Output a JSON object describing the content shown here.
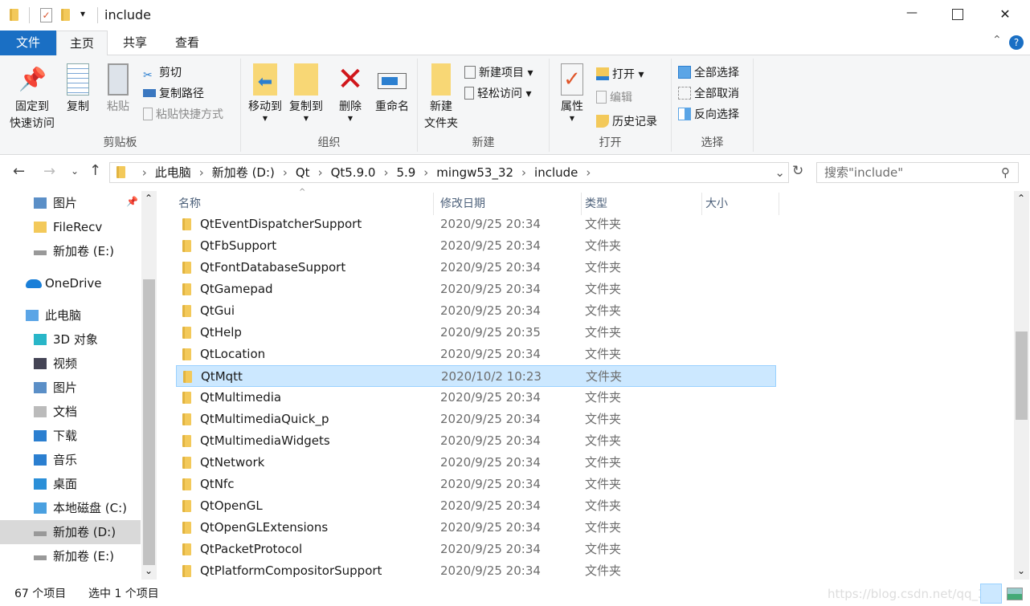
{
  "window": {
    "title": "include",
    "qat_dropdown": "▾",
    "minimize": "—",
    "maximize": "☐",
    "close": "✕"
  },
  "tabs": [
    {
      "label": "文件"
    },
    {
      "label": "主页"
    },
    {
      "label": "共享"
    },
    {
      "label": "查看"
    }
  ],
  "ribbon": {
    "clipboard": {
      "label": "剪贴板",
      "pin": "固定到",
      "pin2": "快速访问",
      "copy": "复制",
      "paste": "粘贴",
      "cut": "剪切",
      "copy_path": "复制路径",
      "paste_shortcut": "粘贴快捷方式"
    },
    "organize": {
      "label": "组织",
      "move_to": "移动到",
      "copy_to": "复制到",
      "delete": "删除",
      "rename": "重命名"
    },
    "new": {
      "label": "新建",
      "new_folder": "新建",
      "new_folder2": "文件夹",
      "new_item": "新建项目 ▾",
      "easy_access": "轻松访问 ▾"
    },
    "open": {
      "label": "打开",
      "properties": "属性",
      "open": "打开 ▾",
      "edit": "编辑",
      "history": "历史记录"
    },
    "select": {
      "label": "选择",
      "select_all": "全部选择",
      "select_none": "全部取消",
      "invert": "反向选择"
    }
  },
  "address": {
    "crumbs": [
      "此电脑",
      "新加卷 (D:)",
      "Qt",
      "Qt5.9.0",
      "5.9",
      "mingw53_32",
      "include"
    ],
    "search_placeholder": "搜索\"include\""
  },
  "nav": [
    {
      "label": "图片",
      "icon": "pictures-icon",
      "indent": 1
    },
    {
      "label": "FileRecv",
      "icon": "folder-icon",
      "indent": 1
    },
    {
      "label": "新加卷 (E:)",
      "icon": "drive-icon",
      "indent": 1
    },
    {
      "label": "OneDrive",
      "icon": "onedrive-icon",
      "indent": 0
    },
    {
      "label": "此电脑",
      "icon": "this-pc-icon",
      "indent": 0
    },
    {
      "label": "3D 对象",
      "icon": "3d-objects-icon",
      "indent": 1
    },
    {
      "label": "视频",
      "icon": "videos-icon",
      "indent": 1
    },
    {
      "label": "图片",
      "icon": "pictures-icon",
      "indent": 1
    },
    {
      "label": "文档",
      "icon": "documents-icon",
      "indent": 1
    },
    {
      "label": "下载",
      "icon": "downloads-icon",
      "indent": 1
    },
    {
      "label": "音乐",
      "icon": "music-icon",
      "indent": 1
    },
    {
      "label": "桌面",
      "icon": "desktop-icon",
      "indent": 1
    },
    {
      "label": "本地磁盘 (C:)",
      "icon": "system-drive-icon",
      "indent": 1
    },
    {
      "label": "新加卷 (D:)",
      "icon": "drive-icon",
      "indent": 1,
      "selected": true
    },
    {
      "label": "新加卷 (E:)",
      "icon": "drive-icon",
      "indent": 1
    }
  ],
  "columns": {
    "name": "名称",
    "date": "修改日期",
    "type": "类型",
    "size": "大小"
  },
  "files": [
    {
      "name": "QtEventDispatcherSupport",
      "date": "2020/9/25 20:34",
      "type": "文件夹"
    },
    {
      "name": "QtFbSupport",
      "date": "2020/9/25 20:34",
      "type": "文件夹"
    },
    {
      "name": "QtFontDatabaseSupport",
      "date": "2020/9/25 20:34",
      "type": "文件夹"
    },
    {
      "name": "QtGamepad",
      "date": "2020/9/25 20:34",
      "type": "文件夹"
    },
    {
      "name": "QtGui",
      "date": "2020/9/25 20:34",
      "type": "文件夹"
    },
    {
      "name": "QtHelp",
      "date": "2020/9/25 20:35",
      "type": "文件夹"
    },
    {
      "name": "QtLocation",
      "date": "2020/9/25 20:34",
      "type": "文件夹"
    },
    {
      "name": "QtMqtt",
      "date": "2020/10/2 10:23",
      "type": "文件夹",
      "selected": true
    },
    {
      "name": "QtMultimedia",
      "date": "2020/9/25 20:34",
      "type": "文件夹"
    },
    {
      "name": "QtMultimediaQuick_p",
      "date": "2020/9/25 20:34",
      "type": "文件夹"
    },
    {
      "name": "QtMultimediaWidgets",
      "date": "2020/9/25 20:34",
      "type": "文件夹"
    },
    {
      "name": "QtNetwork",
      "date": "2020/9/25 20:34",
      "type": "文件夹"
    },
    {
      "name": "QtNfc",
      "date": "2020/9/25 20:34",
      "type": "文件夹"
    },
    {
      "name": "QtOpenGL",
      "date": "2020/9/25 20:34",
      "type": "文件夹"
    },
    {
      "name": "QtOpenGLExtensions",
      "date": "2020/9/25 20:34",
      "type": "文件夹"
    },
    {
      "name": "QtPacketProtocol",
      "date": "2020/9/25 20:34",
      "type": "文件夹"
    },
    {
      "name": "QtPlatformCompositorSupport",
      "date": "2020/9/25 20:34",
      "type": "文件夹"
    }
  ],
  "status": {
    "count": "67 个项目",
    "selected": "选中 1 个项目"
  },
  "watermark": "https://blog.csdn.net/qq_34",
  "colors": {
    "accent": "#1a6fc4",
    "selection": "#cce8ff",
    "folder": "#f3c95a"
  }
}
